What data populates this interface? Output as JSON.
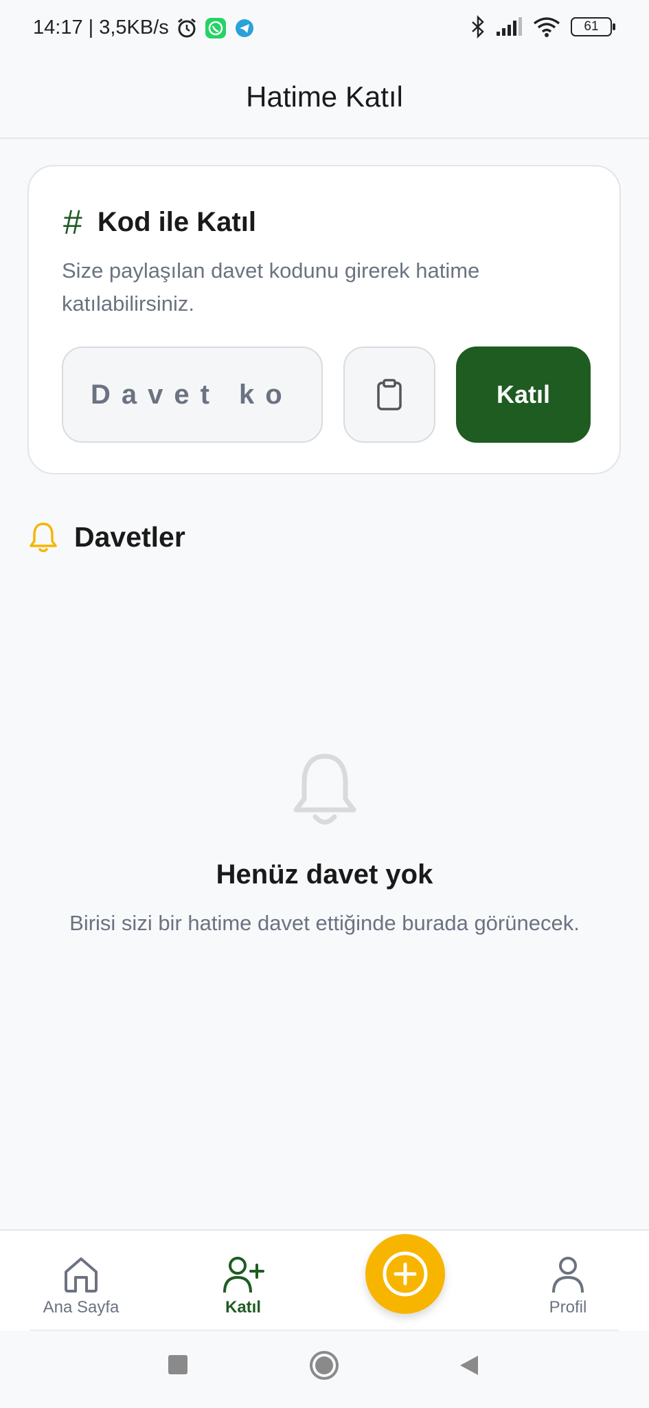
{
  "status_bar": {
    "time_speed": "14:17 | 3,5KB/s",
    "battery": "61",
    "icons": [
      "alarm-icon",
      "whatsapp-icon",
      "telegram-icon",
      "bluetooth-icon",
      "signal-icon",
      "wifi-icon",
      "battery-icon"
    ]
  },
  "header": {
    "title": "Hatime Katıl"
  },
  "join_card": {
    "icon": "hash-icon",
    "hash_glyph": "#",
    "title": "Kod ile Katıl",
    "description": "Size paylaşılan davet kodunu girerek hatime katılabilirsiniz.",
    "code_placeholder": "Davet kodu",
    "code_value": "",
    "paste_icon": "clipboard-icon",
    "join_label": "Katıl"
  },
  "invitations": {
    "icon": "bell-icon",
    "title": "Davetler",
    "empty_title": "Henüz davet yok",
    "empty_desc": "Birisi sizi bir hatime davet ettiğinde burada görünecek."
  },
  "bottom_nav": {
    "items": [
      {
        "label": "Ana Sayfa",
        "icon": "home-icon",
        "active": false
      },
      {
        "label": "Katıl",
        "icon": "user-plus-icon",
        "active": true
      },
      {
        "label": "",
        "icon": "plus-circle-icon",
        "active": false
      },
      {
        "label": "Profil",
        "icon": "user-icon",
        "active": false
      }
    ]
  },
  "colors": {
    "primary_green": "#1e5c22",
    "accent_yellow": "#f7b500",
    "background": "#f8f9fb"
  }
}
